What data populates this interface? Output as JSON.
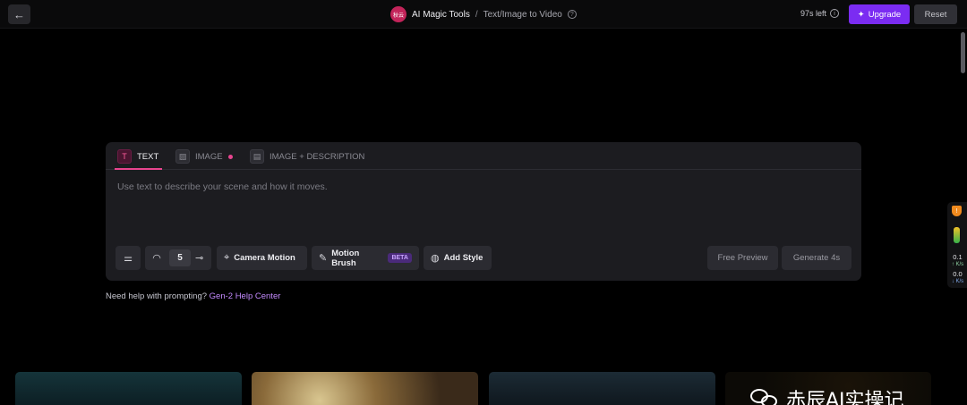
{
  "header": {
    "back_icon": "arrow-left-icon",
    "logo_text": "秋云",
    "app_name": "AI Magic Tools",
    "separator": "/",
    "page_name": "Text/Image to Video",
    "credits": "97s left",
    "upgrade_label": "Upgrade",
    "reset_label": "Reset"
  },
  "tabs": [
    {
      "label": "TEXT",
      "icon": "text-icon",
      "active": true
    },
    {
      "label": "IMAGE",
      "icon": "image-icon",
      "active": false
    },
    {
      "label": "IMAGE + DESCRIPTION",
      "icon": "image-description-icon",
      "active": false
    }
  ],
  "prompt": {
    "placeholder": "Use text to describe your scene and how it moves."
  },
  "toolbar": {
    "duration_value": "5",
    "camera_motion_label": "Camera Motion",
    "motion_brush_label": "Motion Brush",
    "beta_label": "BETA",
    "add_style_label": "Add Style",
    "free_preview_label": "Free Preview",
    "generate_label": "Generate 4s"
  },
  "help": {
    "text": "Need help with prompting?",
    "link": "Gen-2 Help Center"
  },
  "side_widget": {
    "up_value": "0.1",
    "up_unit": "K/s",
    "down_value": "0.0",
    "down_unit": "K/s"
  },
  "watermark": {
    "text": "赤辰AI实操记"
  },
  "colors": {
    "accent": "#7b2cf2",
    "tab_accent": "#e8458f",
    "link": "#c48bff",
    "panel": "#1c1c20"
  }
}
